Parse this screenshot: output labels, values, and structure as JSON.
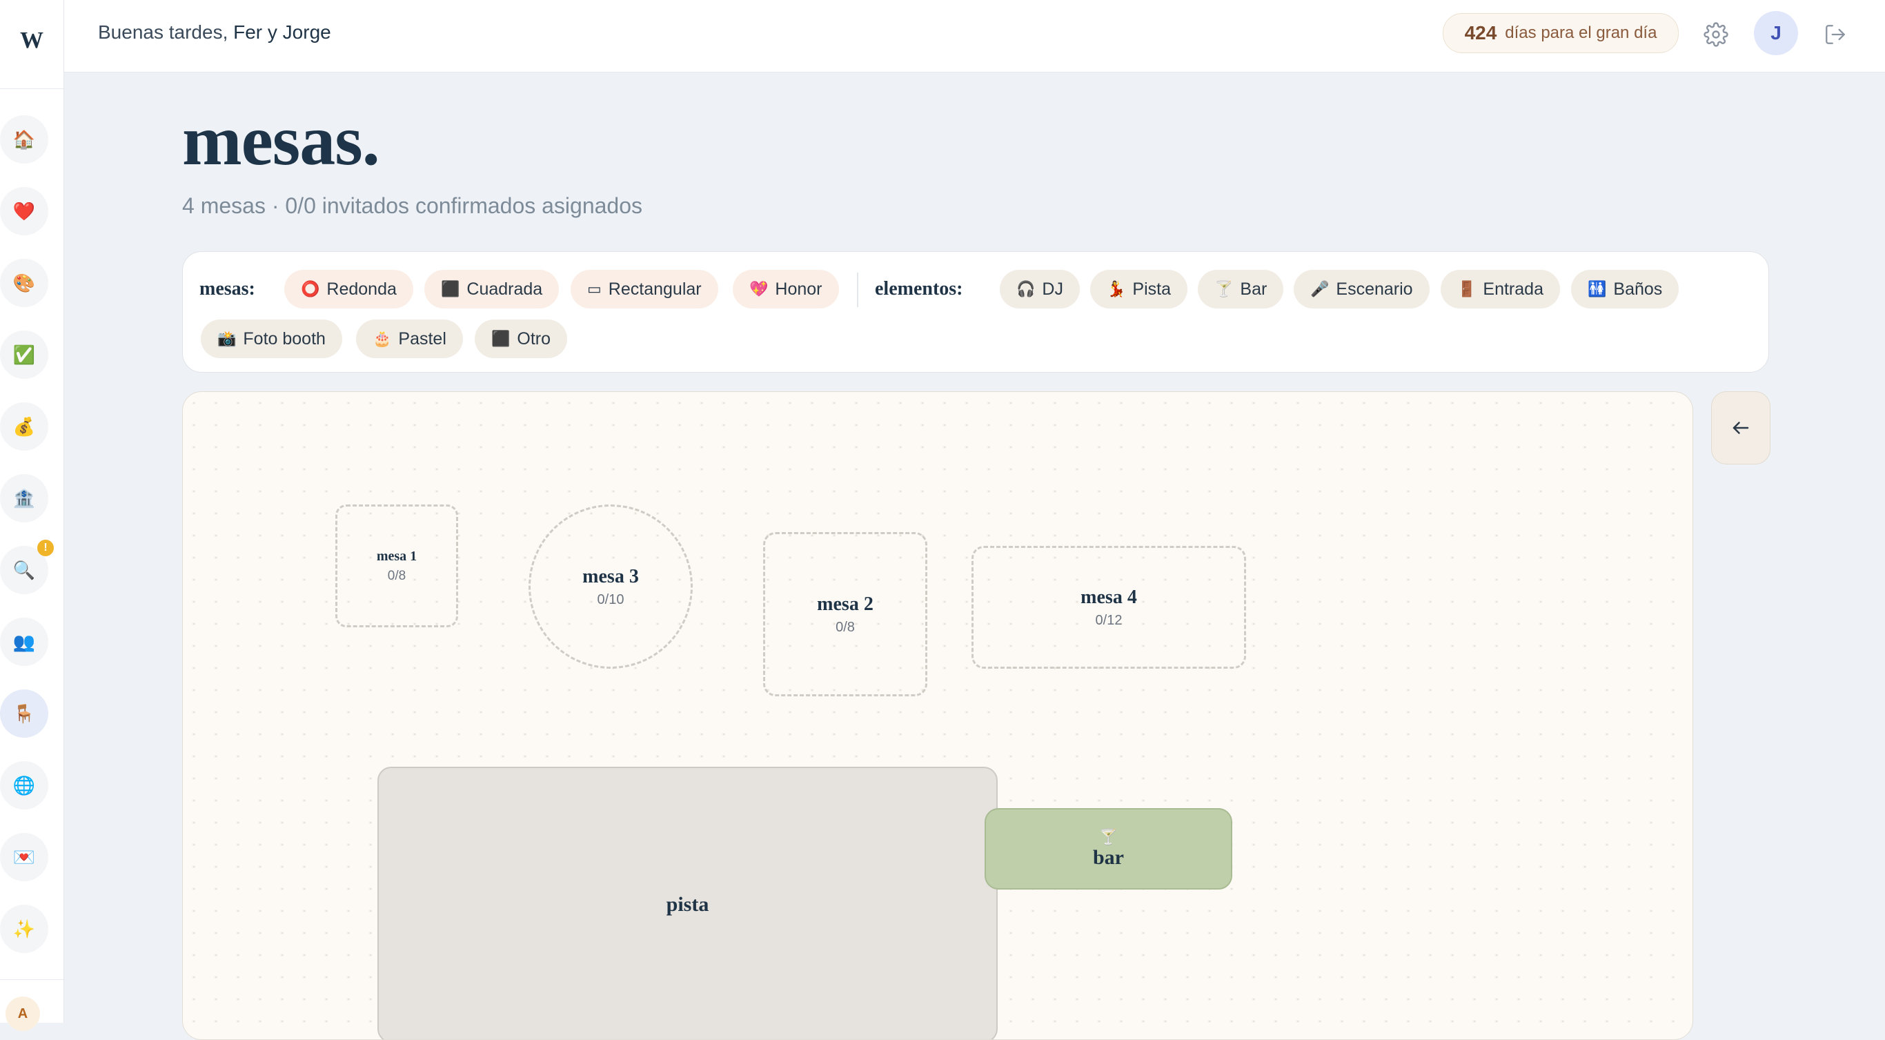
{
  "sidebar": {
    "logo": "W",
    "items": [
      {
        "icon": "🏠",
        "name": "home"
      },
      {
        "icon": "❤️",
        "name": "heart"
      },
      {
        "icon": "🎨",
        "name": "palette"
      },
      {
        "icon": "✅",
        "name": "checklist"
      },
      {
        "icon": "💰",
        "name": "budget"
      },
      {
        "icon": "🏦",
        "name": "venue"
      },
      {
        "icon": "🔍",
        "name": "search"
      },
      {
        "icon": "👥",
        "name": "guests"
      },
      {
        "icon": "🪑",
        "name": "seating"
      },
      {
        "icon": "🌐",
        "name": "website"
      },
      {
        "icon": "💌",
        "name": "invitations"
      },
      {
        "icon": "✨",
        "name": "extras"
      }
    ],
    "badge": "!",
    "user_initial": "A"
  },
  "header": {
    "greeting": "Buenas tardes,",
    "names": "Fer y Jorge",
    "countdown_number": "424",
    "countdown_text": "días para el gran día",
    "avatar_initial": "J"
  },
  "page": {
    "title": "mesas.",
    "subtitle": "4 mesas · 0/0 invitados confirmados asignados"
  },
  "toolbar": {
    "tables_label": "mesas:",
    "tables": [
      {
        "icon": "⭕",
        "label": "Redonda"
      },
      {
        "icon": "⬛",
        "label": "Cuadrada"
      },
      {
        "icon": "▭",
        "label": "Rectangular"
      },
      {
        "icon": "💖",
        "label": "Honor"
      }
    ],
    "elements_label": "elementos:",
    "elements": [
      {
        "icon": "🎧",
        "label": "DJ"
      },
      {
        "icon": "💃",
        "label": "Pista"
      },
      {
        "icon": "🍸",
        "label": "Bar"
      },
      {
        "icon": "🎤",
        "label": "Escenario"
      },
      {
        "icon": "🚪",
        "label": "Entrada"
      },
      {
        "icon": "🚻",
        "label": "Baños"
      },
      {
        "icon": "📸",
        "label": "Foto booth"
      },
      {
        "icon": "🎂",
        "label": "Pastel"
      },
      {
        "icon": "⬛",
        "label": "Otro"
      }
    ]
  },
  "canvas": {
    "tables": [
      {
        "name": "mesa 1",
        "count": "0/8",
        "shape": "square"
      },
      {
        "name": "mesa 3",
        "count": "0/10",
        "shape": "round"
      },
      {
        "name": "mesa 2",
        "count": "0/8",
        "shape": "square"
      },
      {
        "name": "mesa 4",
        "count": "0/12",
        "shape": "rectangular"
      }
    ],
    "elements": [
      {
        "name": "pista",
        "icon": ""
      },
      {
        "name": "bar",
        "icon": "🍸"
      }
    ]
  },
  "colors": {
    "accent": "#1f3346",
    "table_chip_bg": "#fbeee6",
    "element_chip_bg": "#f1ece4",
    "bar_fill": "#bfcfaa",
    "pista_fill": "#e6e2dd"
  }
}
